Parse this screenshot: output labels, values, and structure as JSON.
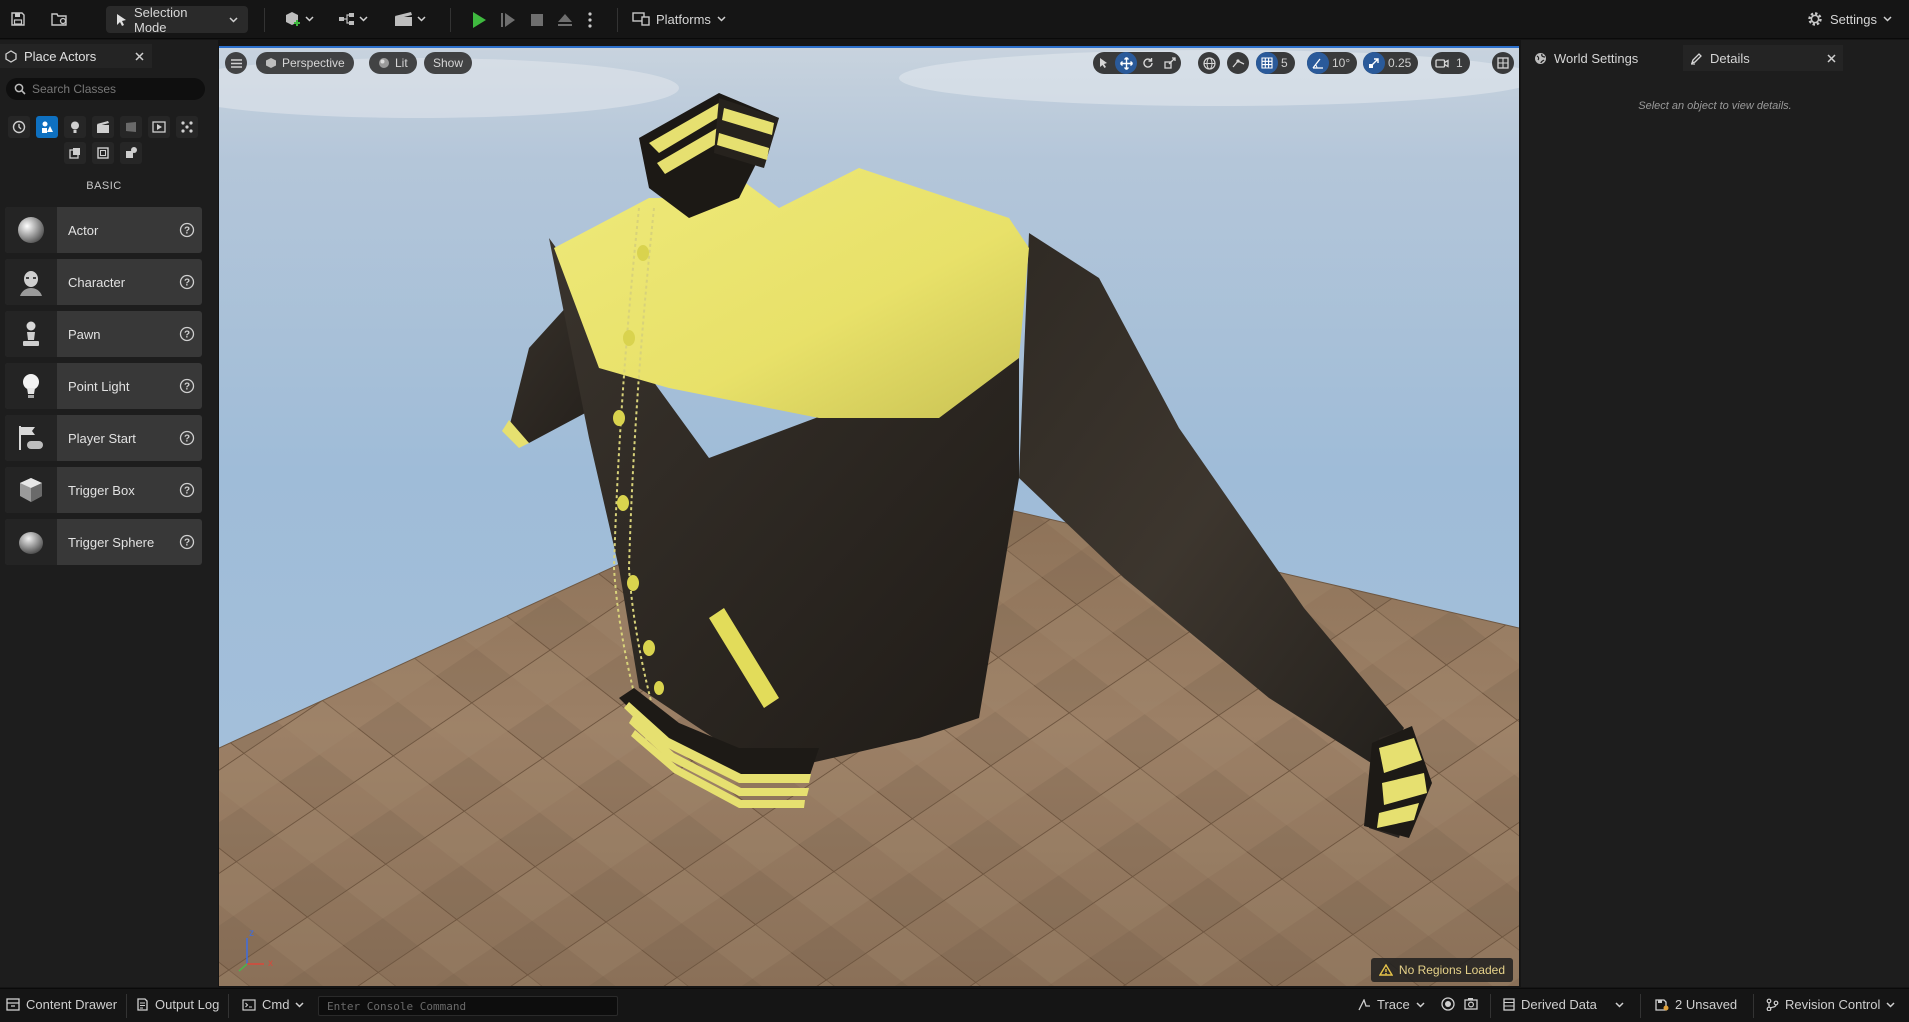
{
  "toolbar": {
    "mode_label": "Selection Mode",
    "platforms_label": "Platforms",
    "settings_label": "Settings"
  },
  "place_actors": {
    "tab_label": "Place Actors",
    "search_placeholder": "Search Classes",
    "section_label": "BASIC",
    "items": [
      {
        "label": "Actor"
      },
      {
        "label": "Character"
      },
      {
        "label": "Pawn"
      },
      {
        "label": "Point Light"
      },
      {
        "label": "Player Start"
      },
      {
        "label": "Trigger Box"
      },
      {
        "label": "Trigger Sphere"
      }
    ]
  },
  "viewport": {
    "perspective_label": "Perspective",
    "lit_label": "Lit",
    "show_label": "Show",
    "grid_snap_value": "5",
    "rotation_snap_value": "10°",
    "scale_snap_value": "0.25",
    "camera_speed_value": "1",
    "status_warning": "No Regions Loaded",
    "axis_labels": {
      "z": "z",
      "x": "x"
    }
  },
  "right_panel": {
    "tab_world_settings": "World Settings",
    "tab_details": "Details",
    "empty_message": "Select an object to view details."
  },
  "status_bar": {
    "content_drawer": "Content Drawer",
    "output_log": "Output Log",
    "cmd_label": "Cmd",
    "console_placeholder": "Enter Console Command",
    "trace_label": "Trace",
    "derived_data_label": "Derived Data",
    "unsaved_label": "2 Unsaved",
    "revision_control_label": "Revision Control"
  },
  "colors": {
    "accent": "#0e70c0",
    "play_green": "#3fb93f",
    "jacket_yellow": "#e8e36a",
    "jacket_dark": "#2a2520",
    "sky": "#a9c3de",
    "floor": "#8e7459",
    "warning": "#e6c34a"
  }
}
